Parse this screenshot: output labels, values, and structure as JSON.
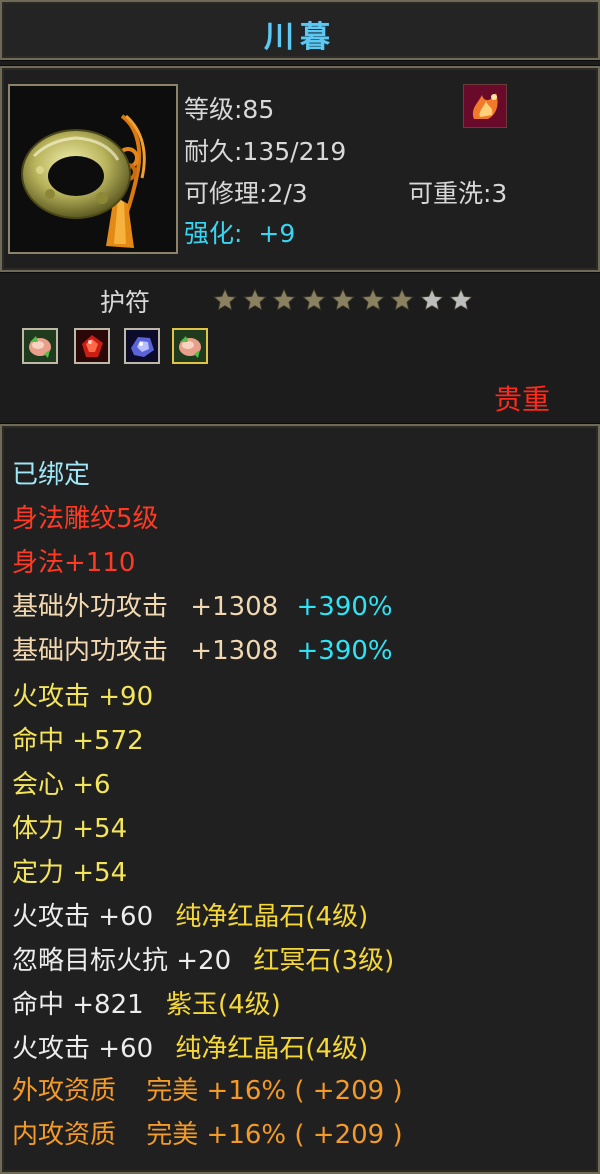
{
  "title": "川暮",
  "item": {
    "level": "等级:85",
    "durability": "耐久:135/219",
    "repairable": "可修理:2/3",
    "rewashable": "可重洗:3",
    "enhance_label": "强化:",
    "enhance_value": "+9",
    "type": "护符",
    "stars_total": 9,
    "stars_filled": 7,
    "rarity": "贵重"
  },
  "icons": {
    "item": "jade-ring-pendant-icon",
    "type_badge": "flame-badge-icon",
    "gems": [
      "green-red-gem-icon",
      "red-gem-icon",
      "blue-gem-icon",
      "green-red-gem-icon"
    ]
  },
  "attributes": {
    "bound": "已绑定",
    "engrave": "身法雕纹5级",
    "agility": "身法+110",
    "ext_atk_label": "基础外功攻击",
    "ext_atk_value": "+1308",
    "ext_atk_pct": "+390%",
    "int_atk_label": "基础内功攻击",
    "int_atk_value": "+1308",
    "int_atk_pct": "+390%",
    "fire_atk": "火攻击  +90",
    "hit": "命中  +572",
    "crit": "会心  +6",
    "stamina": "体力  +54",
    "focus": "定力  +54",
    "gem1_label": "火攻击  +60",
    "gem1_name": "纯净红晶石(4级)",
    "gem2_label": "忽略目标火抗  +20",
    "gem2_name": "红冥石(3级)",
    "gem3_label": "命中  +821",
    "gem3_name": "紫玉(4级)",
    "gem4_label": "火攻击  +60",
    "gem4_name": "纯净红晶石(4级)",
    "q1_label": "外攻资质",
    "q1_value": "完美  +16%  ( +209 )",
    "q2_label": "内攻资质",
    "q2_value": "完美  +16%  ( +209 )"
  },
  "colors": {
    "title": "#5fc8f0",
    "enhance": "#36d6f2",
    "rarity": "#ff2a1a",
    "star_filled": "#8a8160",
    "star_empty": "#bdbdbd"
  }
}
